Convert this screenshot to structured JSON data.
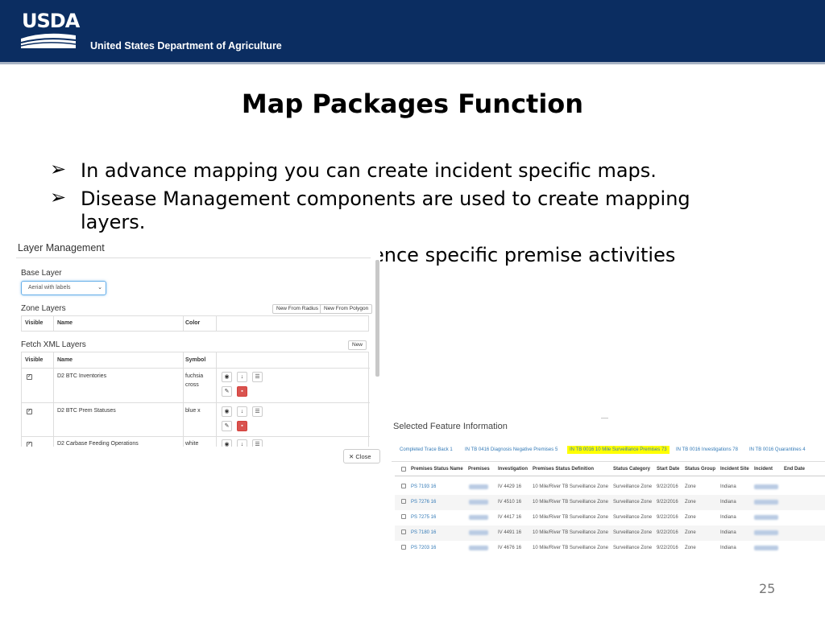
{
  "header": {
    "logo_text": "USDA",
    "department": "United States Department of Agriculture"
  },
  "slide": {
    "title": "Map Packages Function",
    "bullets": [
      "In advance mapping you can create incident specific maps.",
      "Disease Management components are used to create mapping layers.",
      "ence specific premise activities"
    ],
    "page_number": "25"
  },
  "layer_management": {
    "title": "Layer Management",
    "base_layer_label": "Base Layer",
    "base_layer_value": "Aerial with labels",
    "zone_layers_label": "Zone Layers",
    "new_from_radius": "New From Radius",
    "new_from_polygon": "New From Polygon",
    "zone_columns": [
      "Visible",
      "Name",
      "Color"
    ],
    "fetch_label": "Fetch XML Layers",
    "new_button": "New",
    "fetch_columns": [
      "Visible",
      "Name",
      "Symbol"
    ],
    "rows": [
      {
        "name": "D2 BTC Inventories",
        "symbol": "fuchsia cross",
        "checked": true
      },
      {
        "name": "D2 BTC Prem Statuses",
        "symbol": "blue x",
        "checked": true
      },
      {
        "name": "D2 Carbase Feeding Operations",
        "symbol": "white",
        "checked": true
      }
    ],
    "close_label": "Close"
  },
  "selected_feature": {
    "title": "Selected Feature Information",
    "tabs": [
      "Completed Trace Back 1",
      "IN TB 0416 Diagnosis Negative Premises 5",
      "IN TB 0016 10 Mile Surveillance Premises 73",
      "IN TB 0016 Investigations 78",
      "IN TB 0016 Quarantines 4"
    ],
    "active_tab": 2,
    "columns": [
      "Premises Status Name",
      "Premises",
      "Investigation",
      "Premises Status Definition",
      "Status Category",
      "Start Date",
      "Status Group",
      "Incident Site",
      "Incident",
      "End Date"
    ],
    "rows": [
      {
        "status_name": "PS 7193 16",
        "investigation": "IV 4429 16",
        "definition": "10 Mile/River TB Surveillance Zone",
        "category": "Surveillance Zone",
        "start": "9/22/2016",
        "group": "Zone",
        "site": "Indiana"
      },
      {
        "status_name": "PS 7276 16",
        "investigation": "IV 4510 16",
        "definition": "10 Mile/River TB Surveillance Zone",
        "category": "Surveillance Zone",
        "start": "9/22/2016",
        "group": "Zone",
        "site": "Indiana"
      },
      {
        "status_name": "PS 7275 16",
        "investigation": "IV 4417 16",
        "definition": "10 Mile/River TB Surveillance Zone",
        "category": "Surveillance Zone",
        "start": "9/22/2016",
        "group": "Zone",
        "site": "Indiana"
      },
      {
        "status_name": "PS 7180 16",
        "investigation": "IV 4491 16",
        "definition": "10 Mile/River TB Surveillance Zone",
        "category": "Surveillance Zone",
        "start": "9/22/2016",
        "group": "Zone",
        "site": "Indiana"
      },
      {
        "status_name": "PS 7203 16",
        "investigation": "IV 4676 16",
        "definition": "10 Mile/River TB Surveillance Zone",
        "category": "Surveillance Zone",
        "start": "9/22/2016",
        "group": "Zone",
        "site": "Indiana"
      }
    ]
  },
  "colors": {
    "header_bg": "#0b2d61",
    "highlight": "#ffff00",
    "danger": "#d9534f",
    "link": "#337ab7"
  }
}
